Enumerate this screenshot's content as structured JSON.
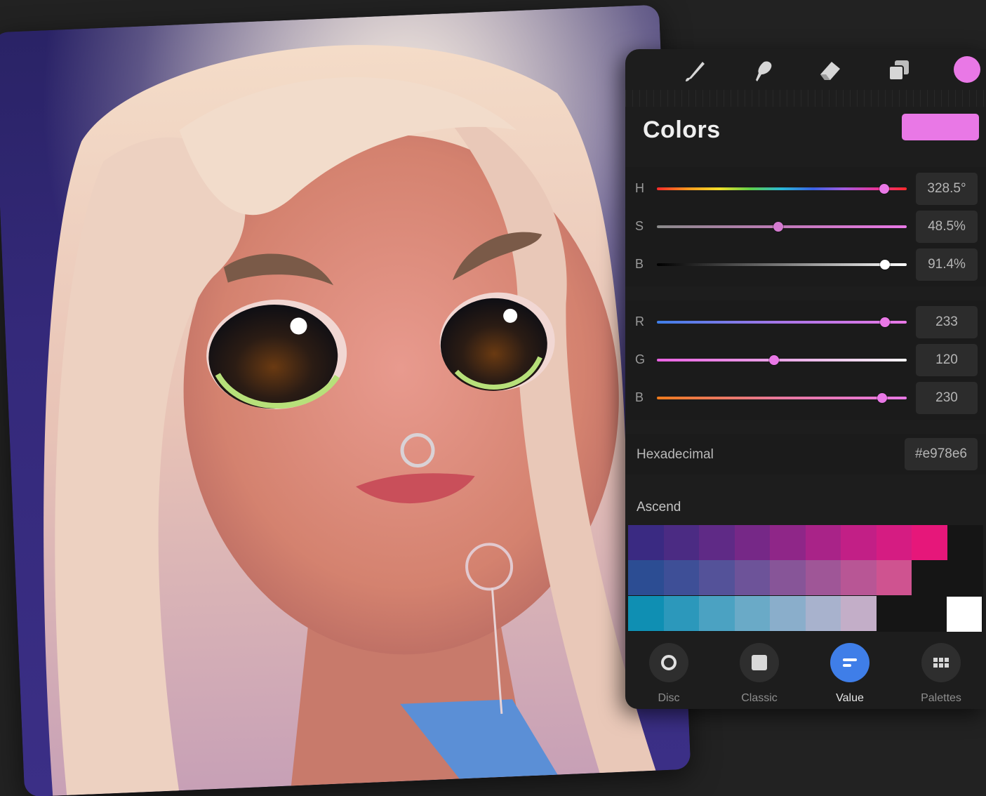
{
  "toolbar": {
    "tools": [
      "brush-icon",
      "smudge-icon",
      "eraser-icon",
      "layers-icon"
    ],
    "active_color": "#e978e6"
  },
  "panel": {
    "title": "Colors",
    "current_color": "#e978e6"
  },
  "hsb": [
    {
      "label": "H",
      "value": "328.5°",
      "fraction": 0.91
    },
    {
      "label": "S",
      "value": "48.5%",
      "fraction": 0.485
    },
    {
      "label": "B",
      "value": "91.4%",
      "fraction": 0.914
    }
  ],
  "rgb": [
    {
      "label": "R",
      "value": "233",
      "fraction": 0.914
    },
    {
      "label": "G",
      "value": "120",
      "fraction": 0.47
    },
    {
      "label": "B",
      "value": "230",
      "fraction": 0.902
    }
  ],
  "hex": {
    "label": "Hexadecimal",
    "value": "#e978e6"
  },
  "palette": {
    "title": "Ascend",
    "rows": [
      [
        "#3a2a82",
        "#4b2b83",
        "#5f2a86",
        "#762887",
        "#8f2688",
        "#a92388",
        "#c21f86",
        "#d51c82",
        "#e6177a"
      ],
      [
        "#2c4d93",
        "#3e4f97",
        "#545299",
        "#6d5399",
        "#875598",
        "#9f5697",
        "#b85695",
        "#cf5390"
      ],
      [
        "#0f8fb3",
        "#2c98bb",
        "#4ba2c2",
        "#6aaac7",
        "#8aaecb",
        "#a8b2cd",
        "#c3aec8"
      ]
    ],
    "extra_swatch": "#ffffff"
  },
  "modes": [
    {
      "label": "Disc",
      "icon": "disc-icon",
      "active": false
    },
    {
      "label": "Classic",
      "icon": "classic-square-icon",
      "active": false
    },
    {
      "label": "Value",
      "icon": "value-sliders-icon",
      "active": true
    },
    {
      "label": "Palettes",
      "icon": "palettes-grid-icon",
      "active": false
    }
  ]
}
